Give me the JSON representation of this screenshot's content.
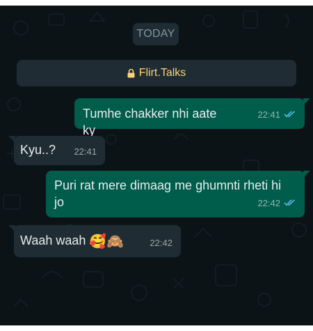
{
  "date_chip": "TODAY",
  "banner": {
    "lock_icon": "lock-icon",
    "title": "Flirt.Talks",
    "color": "#ffd279"
  },
  "messages": [
    {
      "direction": "outgoing",
      "text": "Tumhe chakker nhi aate ky",
      "time": "22:41",
      "status": "read"
    },
    {
      "direction": "incoming",
      "text": "Kyu..?",
      "time": "22:41"
    },
    {
      "direction": "outgoing",
      "text": "Puri rat mere dimaag me ghumnti rheti hi jo",
      "time": "22:42",
      "status": "read"
    },
    {
      "direction": "incoming",
      "text": "Waah waah",
      "emoji": "🥰🙈",
      "time": "22:42"
    }
  ],
  "colors": {
    "background": "#0c1317",
    "outgoing_bubble": "#005c4b",
    "incoming_bubble": "#1f2c33",
    "read_ticks": "#53bdeb"
  }
}
